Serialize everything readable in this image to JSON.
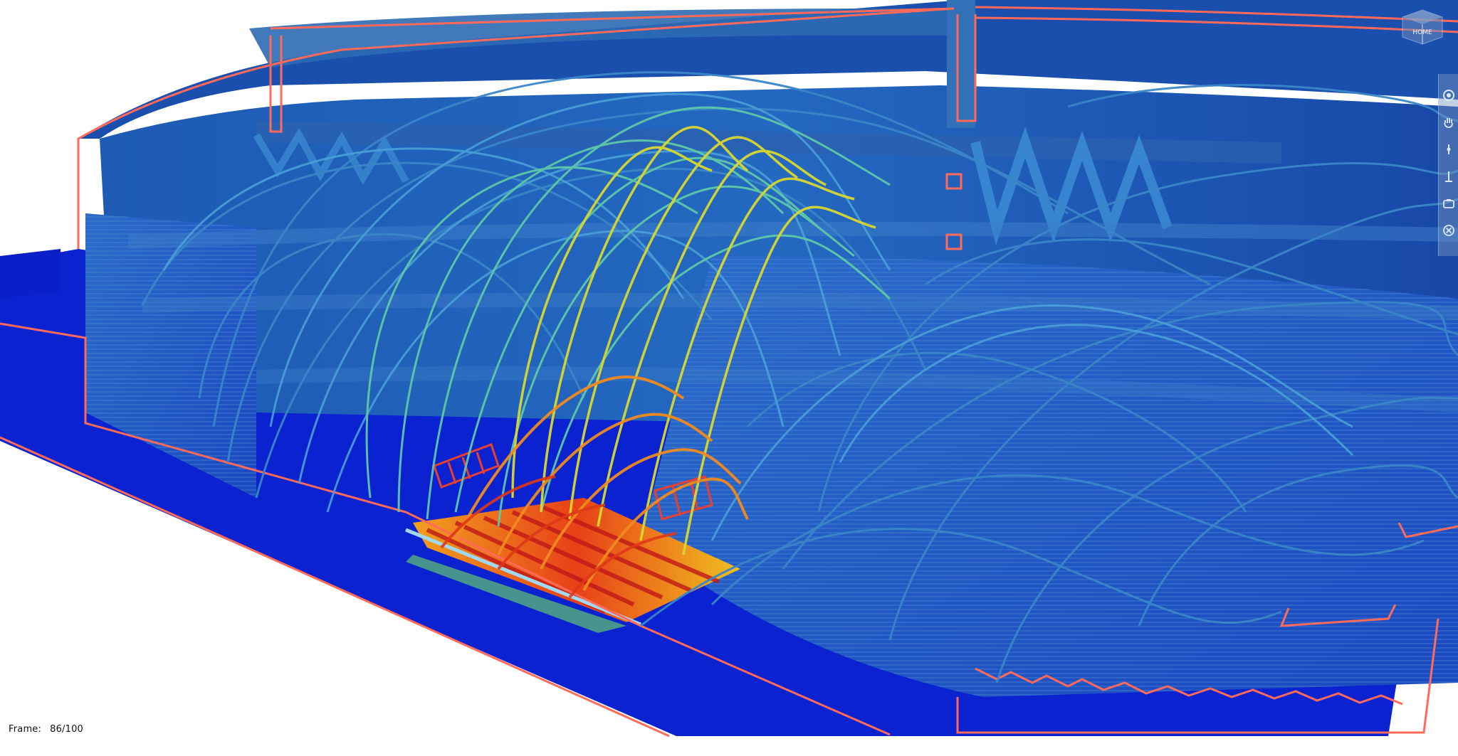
{
  "viewer": {
    "frame_label": "Frame:",
    "frame_value": "86/100"
  },
  "viewcube": {
    "label": "HOME",
    "icon": "viewcube-icon"
  },
  "toolbar": {
    "tools": [
      {
        "name": "orbit-tool",
        "icon": "orbit-icon"
      },
      {
        "name": "pan-tool",
        "icon": "hand-icon"
      },
      {
        "name": "zoom-tool",
        "icon": "zoom-icon"
      },
      {
        "name": "section-tool",
        "icon": "section-icon"
      },
      {
        "name": "camera-tool",
        "icon": "camera-icon"
      },
      {
        "name": "reset-tool",
        "icon": "close-circle-icon"
      }
    ]
  },
  "colors": {
    "background": "#ffffff",
    "floor_blue": "#0a1fd6",
    "structure_blue": "#2a5da8",
    "outline_red": "#ff6a5a",
    "stream_cold": "#2f7fc4",
    "stream_mid": "#5fd0a0",
    "stream_warm": "#d8e030",
    "stream_hot": "#e8401e"
  }
}
